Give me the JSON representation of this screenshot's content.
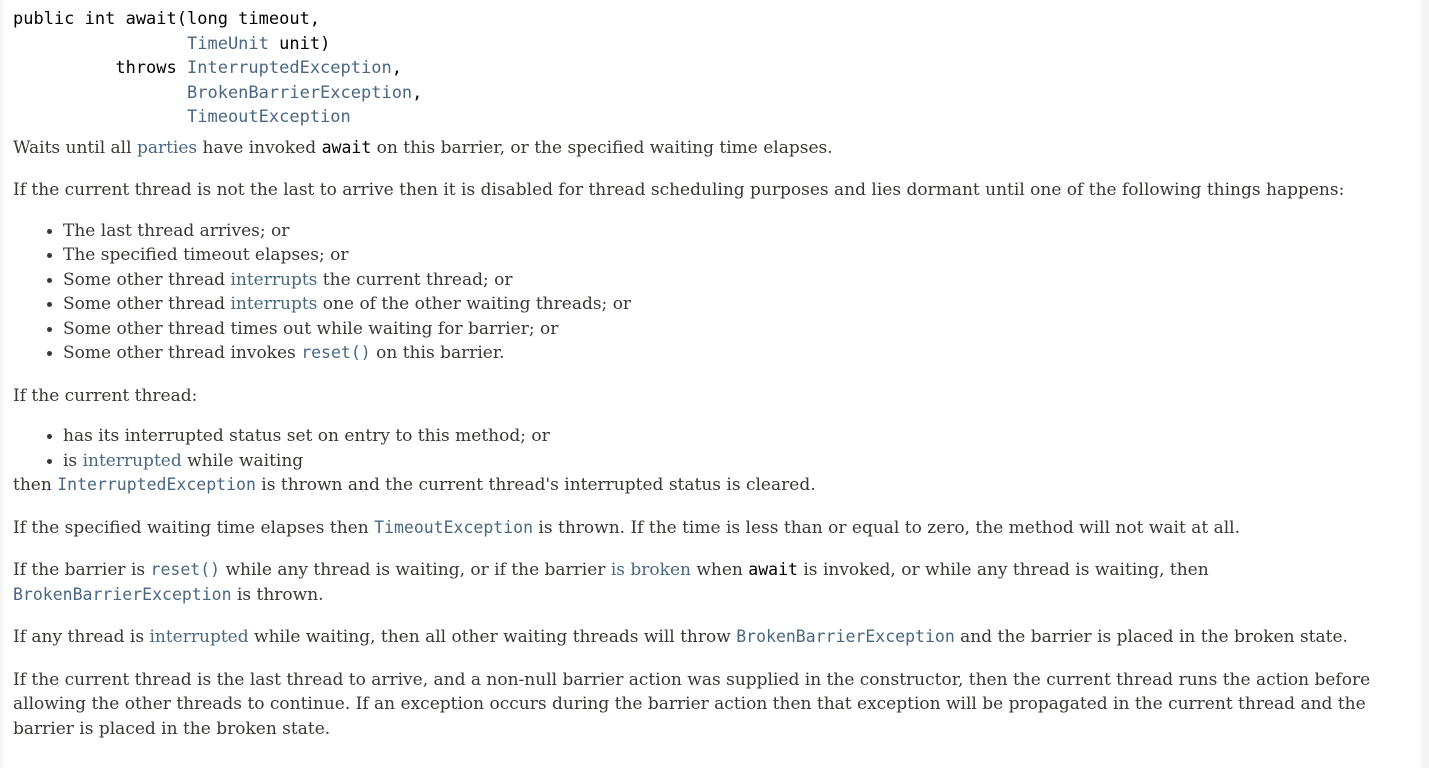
{
  "signature": {
    "line1": "public int await(long timeout,",
    "line2_indent": "                 ",
    "line2_type": "TimeUnit",
    "line2_rest": " unit)",
    "line3_indent": "          throws ",
    "line3_type": "InterruptedException",
    "line3_rest": ",",
    "line4_indent": "                 ",
    "line4_type": "BrokenBarrierException",
    "line4_rest": ",",
    "line5_indent": "                 ",
    "line5_type": "TimeoutException"
  },
  "p1": {
    "t1": "Waits until all ",
    "link": "parties",
    "t2": " have invoked ",
    "code": "await",
    "t3": " on this barrier, or the specified waiting time elapses."
  },
  "p2": "If the current thread is not the last to arrive then it is disabled for thread scheduling purposes and lies dormant until one of the following things happens:",
  "list1": {
    "i1": "The last thread arrives; or",
    "i2": "The specified timeout elapses; or",
    "i3_t1": "Some other thread ",
    "i3_link": "interrupts",
    "i3_t2": " the current thread; or",
    "i4_t1": "Some other thread ",
    "i4_link": "interrupts",
    "i4_t2": " one of the other waiting threads; or",
    "i5": "Some other thread times out while waiting for barrier; or",
    "i6_t1": "Some other thread invokes ",
    "i6_code": "reset()",
    "i6_t2": " on this barrier."
  },
  "p3": "If the current thread:",
  "list2": {
    "i1": "has its interrupted status set on entry to this method; or",
    "i2_t1": "is ",
    "i2_link": "interrupted",
    "i2_t2": " while waiting"
  },
  "p4": {
    "t1": "then ",
    "code": "InterruptedException",
    "t2": " is thrown and the current thread's interrupted status is cleared."
  },
  "p5": {
    "t1": "If the specified waiting time elapses then ",
    "code": "TimeoutException",
    "t2": " is thrown. If the time is less than or equal to zero, the method will not wait at all."
  },
  "p6": {
    "t1": "If the barrier is ",
    "code1": "reset()",
    "t2": " while any thread is waiting, or if the barrier ",
    "link": "is broken",
    "t3": " when ",
    "code2": "await",
    "t4": " is invoked, or while any thread is waiting, then",
    "code3": "BrokenBarrierException",
    "t5": " is thrown."
  },
  "p7": {
    "t1": "If any thread is ",
    "link": "interrupted",
    "t2": " while waiting, then all other waiting threads will throw ",
    "code": "BrokenBarrierException",
    "t3": " and the barrier is placed in the broken state."
  },
  "p8": {
    "line1": "If the current thread is the last thread to arrive, and a non-null barrier action was supplied in the constructor, then the current thread runs the action before",
    "line2": "allowing the other threads to continue. If an exception occurs during the barrier action then that exception will be propagated in the current thread and the",
    "line3": "barrier is placed in the broken state."
  }
}
